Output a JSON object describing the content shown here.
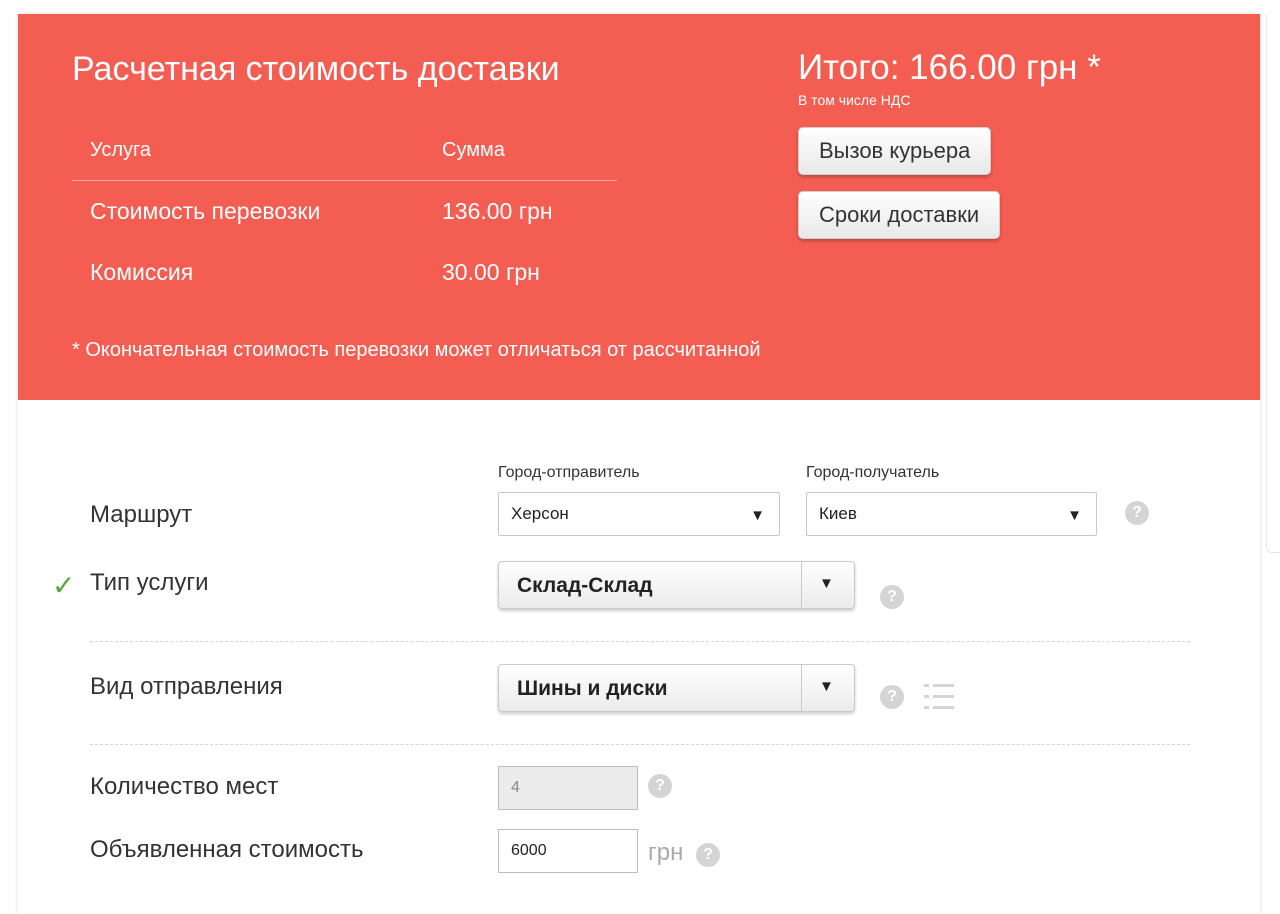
{
  "banner": {
    "title": "Расчетная стоимость доставки",
    "table": {
      "headers": [
        "Услуга",
        "Сумма"
      ],
      "rows": [
        {
          "service": "Стоимость перевозки",
          "amount": "136.00 грн"
        },
        {
          "service": "Комиссия",
          "amount": "30.00 грн"
        }
      ]
    },
    "note": "* Окончательная стоимость перевозки может отличаться от рассчитанной",
    "total": "Итого: 166.00 грн *",
    "vat_note": "В том числе НДС",
    "courier_button": "Вызов курьера",
    "terms_button": "Сроки доставки"
  },
  "form": {
    "route": {
      "label": "Маршрут",
      "from_label": "Город-отправитель",
      "from_value": "Херсон",
      "to_label": "Город-получатель",
      "to_value": "Киев"
    },
    "service_type": {
      "label": "Тип услуги",
      "value": "Склад-Склад"
    },
    "shipment_type": {
      "label": "Вид отправления",
      "value": "Шины и диски"
    },
    "places": {
      "label": "Количество мест",
      "value": "4"
    },
    "declared_value": {
      "label": "Объявленная стоимость",
      "value": "6000",
      "unit": "грн"
    }
  },
  "icons": {
    "help": "question-circle-icon",
    "check": "checkmark-icon",
    "list": "list-icon",
    "dropdown": "triangle-down-icon"
  },
  "colors": {
    "banner": "#f45d52",
    "check": "#5aa63a",
    "help": "#d4d4d4"
  }
}
